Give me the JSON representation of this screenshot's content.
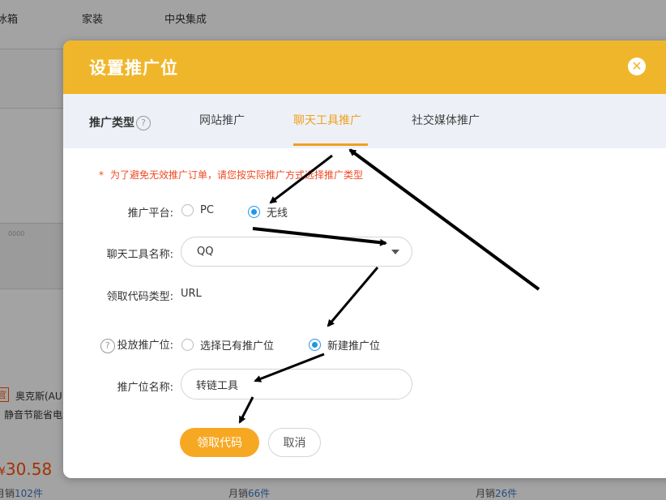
{
  "background": {
    "nav_items": [
      "冰箱",
      "家装",
      "中央集成"
    ],
    "product_brand_badge": "官",
    "product_name": "奥克斯(AU",
    "product_desc": "静音节能省电",
    "price_currency": "¥",
    "price": "30.58",
    "sales": [
      {
        "prefix": "月销",
        "count": "102件"
      },
      {
        "prefix": "月销",
        "count": "66件"
      },
      {
        "prefix": "月销",
        "count": "26件"
      }
    ],
    "image_caption": "0000"
  },
  "dialog": {
    "title": "设置推广位",
    "close_icon": "close-circle-icon",
    "tabs": {
      "type_label": "推广类型",
      "help_glyph": "?",
      "items": [
        {
          "label": "网站推广",
          "active": false
        },
        {
          "label": "聊天工具推广",
          "active": true
        },
        {
          "label": "社交媒体推广",
          "active": false
        }
      ]
    },
    "notice": {
      "star": "*",
      "text": "为了避免无效推广订单，请您按实际推广方式选择推广类型"
    },
    "platform": {
      "label": "推广平台:",
      "options": [
        {
          "label": "PC",
          "checked": false
        },
        {
          "label": "无线",
          "checked": true
        }
      ]
    },
    "chat_tool": {
      "label": "聊天工具名称:",
      "value": "QQ"
    },
    "code_type": {
      "label": "领取代码类型:",
      "value": "URL"
    },
    "placement": {
      "help_glyph": "?",
      "label": "投放推广位:",
      "options": [
        {
          "label": "选择已有推广位",
          "checked": false
        },
        {
          "label": "新建推广位",
          "checked": true
        }
      ]
    },
    "placement_name": {
      "label": "推广位名称:",
      "value": "转链工具"
    },
    "buttons": {
      "get_code": "领取代码",
      "cancel": "取消"
    }
  },
  "colors": {
    "header": "#f0b62b",
    "accent_tab": "#f0a020",
    "primary_button": "#f7a823",
    "radio_checked": "#1e96ea",
    "notice_text": "#f04a22",
    "annotation_arrows": "#000000"
  }
}
